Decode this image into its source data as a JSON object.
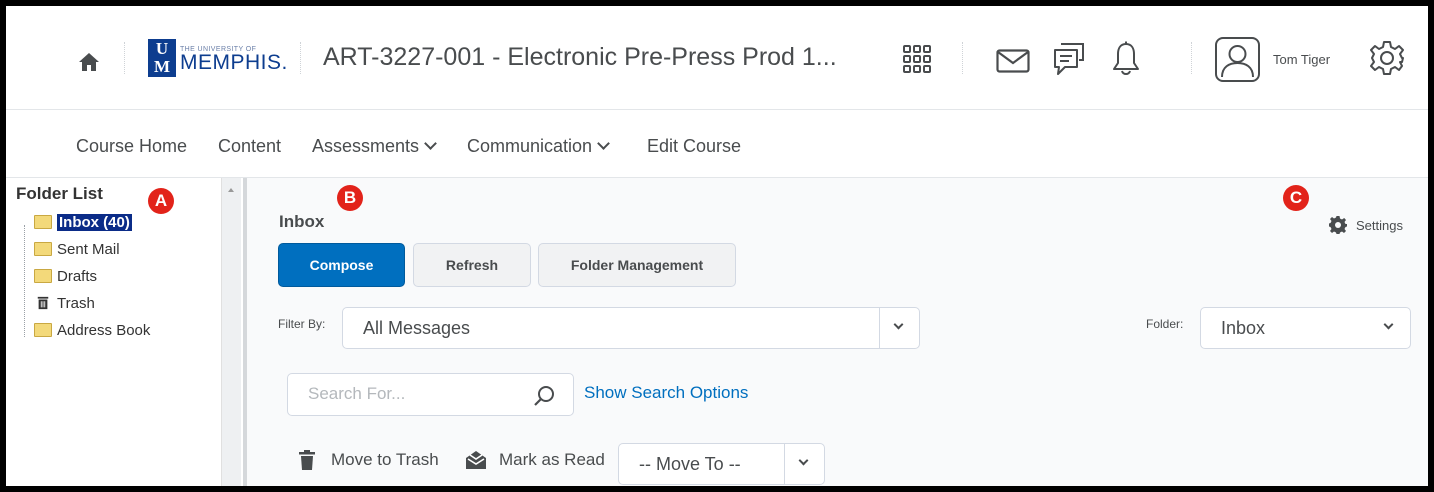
{
  "header": {
    "logo": {
      "small_text": "THE UNIVERSITY OF",
      "big_text": "MEMPHIS.",
      "mark_u": "U",
      "mark_m": "M"
    },
    "course_title": "ART-3227-001 - Electronic Pre-Press Prod 1...",
    "user_name": "Tom Tiger",
    "icons": [
      "home-icon",
      "apps-grid-icon",
      "email-icon",
      "chat-icon",
      "bell-icon",
      "user-avatar-icon",
      "settings-gear-icon"
    ]
  },
  "course_nav": {
    "items": [
      {
        "label": "Course Home"
      },
      {
        "label": "Content"
      },
      {
        "label": "Assessments",
        "has_dropdown": true
      },
      {
        "label": "Communication",
        "has_dropdown": true
      },
      {
        "label": "Edit Course"
      }
    ]
  },
  "folder_panel": {
    "title": "Folder List",
    "items": [
      {
        "label": "Inbox (40)",
        "icon": "folder-icon",
        "selected": true
      },
      {
        "label": "Sent Mail",
        "icon": "folder-icon"
      },
      {
        "label": "Drafts",
        "icon": "folder-icon"
      },
      {
        "label": "Trash",
        "icon": "trash-icon"
      },
      {
        "label": "Address Book",
        "icon": "folder-icon"
      }
    ]
  },
  "main": {
    "title": "Inbox",
    "settings_label": "Settings",
    "buttons": {
      "compose": "Compose",
      "refresh": "Refresh",
      "folder_management": "Folder Management"
    },
    "filter": {
      "label": "Filter By:",
      "value": "All Messages"
    },
    "folder_select": {
      "label": "Folder:",
      "value": "Inbox"
    },
    "search": {
      "placeholder": "Search For...",
      "value": ""
    },
    "show_search_options": "Show Search Options",
    "actions": {
      "move_to_trash": "Move to Trash",
      "mark_as_read": "Mark as Read",
      "move_to": "-- Move To --"
    }
  },
  "annotations": {
    "a": "A",
    "b": "B",
    "c": "C"
  },
  "colors": {
    "primary": "#006fbf",
    "selected_folder": "#0b2c88",
    "badge": "#e2231a",
    "logo_blue": "#0d3d8f"
  }
}
